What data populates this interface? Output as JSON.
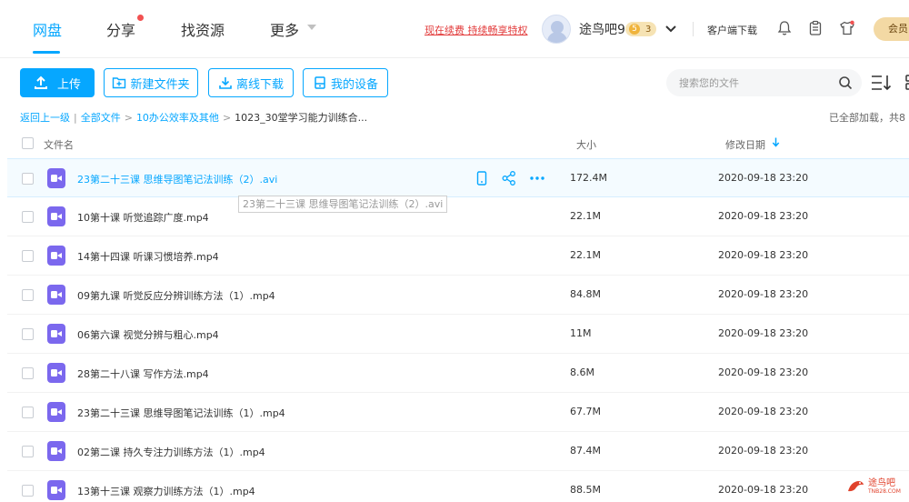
{
  "nav": {
    "items": [
      {
        "label": "网盘",
        "active": true
      },
      {
        "label": "分享",
        "active": false
      },
      {
        "label": "找资源",
        "active": false
      },
      {
        "label": "更多",
        "active": false
      }
    ],
    "renew_link": "现在续费 持续畅享特权",
    "username": "途鸟吧9",
    "vip_level_a": "5",
    "vip_level_b": "3",
    "client_download": "客户端下载",
    "member_button": "会员"
  },
  "toolbar": {
    "upload": "上传",
    "new_folder": "新建文件夹",
    "offline_download": "离线下载",
    "my_devices": "我的设备",
    "search_placeholder": "搜索您的文件"
  },
  "breadcrumb": {
    "back": "返回上一级",
    "all_files": "全部文件",
    "folder": "10办公效率及其他",
    "current": "1023_30堂学习能力训练合..."
  },
  "loaded_info": "已全部加载，共8",
  "table": {
    "headers": {
      "name": "文件名",
      "size": "大小",
      "date": "修改日期"
    },
    "rows": [
      {
        "name": "23第二十三课 思维导图笔记法训练（2）.avi",
        "size": "172.4M",
        "date": "2020-09-18 23:20"
      },
      {
        "name": "10第十课 听觉追踪广度.mp4",
        "size": "22.1M",
        "date": "2020-09-18 23:20"
      },
      {
        "name": "14第十四课 听课习惯培养.mp4",
        "size": "22.1M",
        "date": "2020-09-18 23:20"
      },
      {
        "name": "09第九课 听觉反应分辨训练方法（1）.mp4",
        "size": "84.8M",
        "date": "2020-09-18 23:20"
      },
      {
        "name": "06第六课 视觉分辨与粗心.mp4",
        "size": "11M",
        "date": "2020-09-18 23:20"
      },
      {
        "name": "28第二十八课 写作方法.mp4",
        "size": "8.6M",
        "date": "2020-09-18 23:20"
      },
      {
        "name": "23第二十三课 思维导图笔记法训练（1）.mp4",
        "size": "67.7M",
        "date": "2020-09-18 23:20"
      },
      {
        "name": "02第二课 持久专注力训练方法（1）.mp4",
        "size": "87.4M",
        "date": "2020-09-18 23:20"
      },
      {
        "name": "13第十三课 观察力训练方法（1）.mp4",
        "size": "88.5M",
        "date": "2020-09-18 23:20"
      }
    ]
  },
  "tooltip": "23第二十三课 思维导图笔记法训练（2）.avi",
  "watermark": {
    "text": "途鸟吧",
    "sub": "TNB28.COM"
  },
  "colors": {
    "accent": "#06a7ff",
    "renew": "#e23a3a",
    "video_icon": "#7b68ee"
  }
}
